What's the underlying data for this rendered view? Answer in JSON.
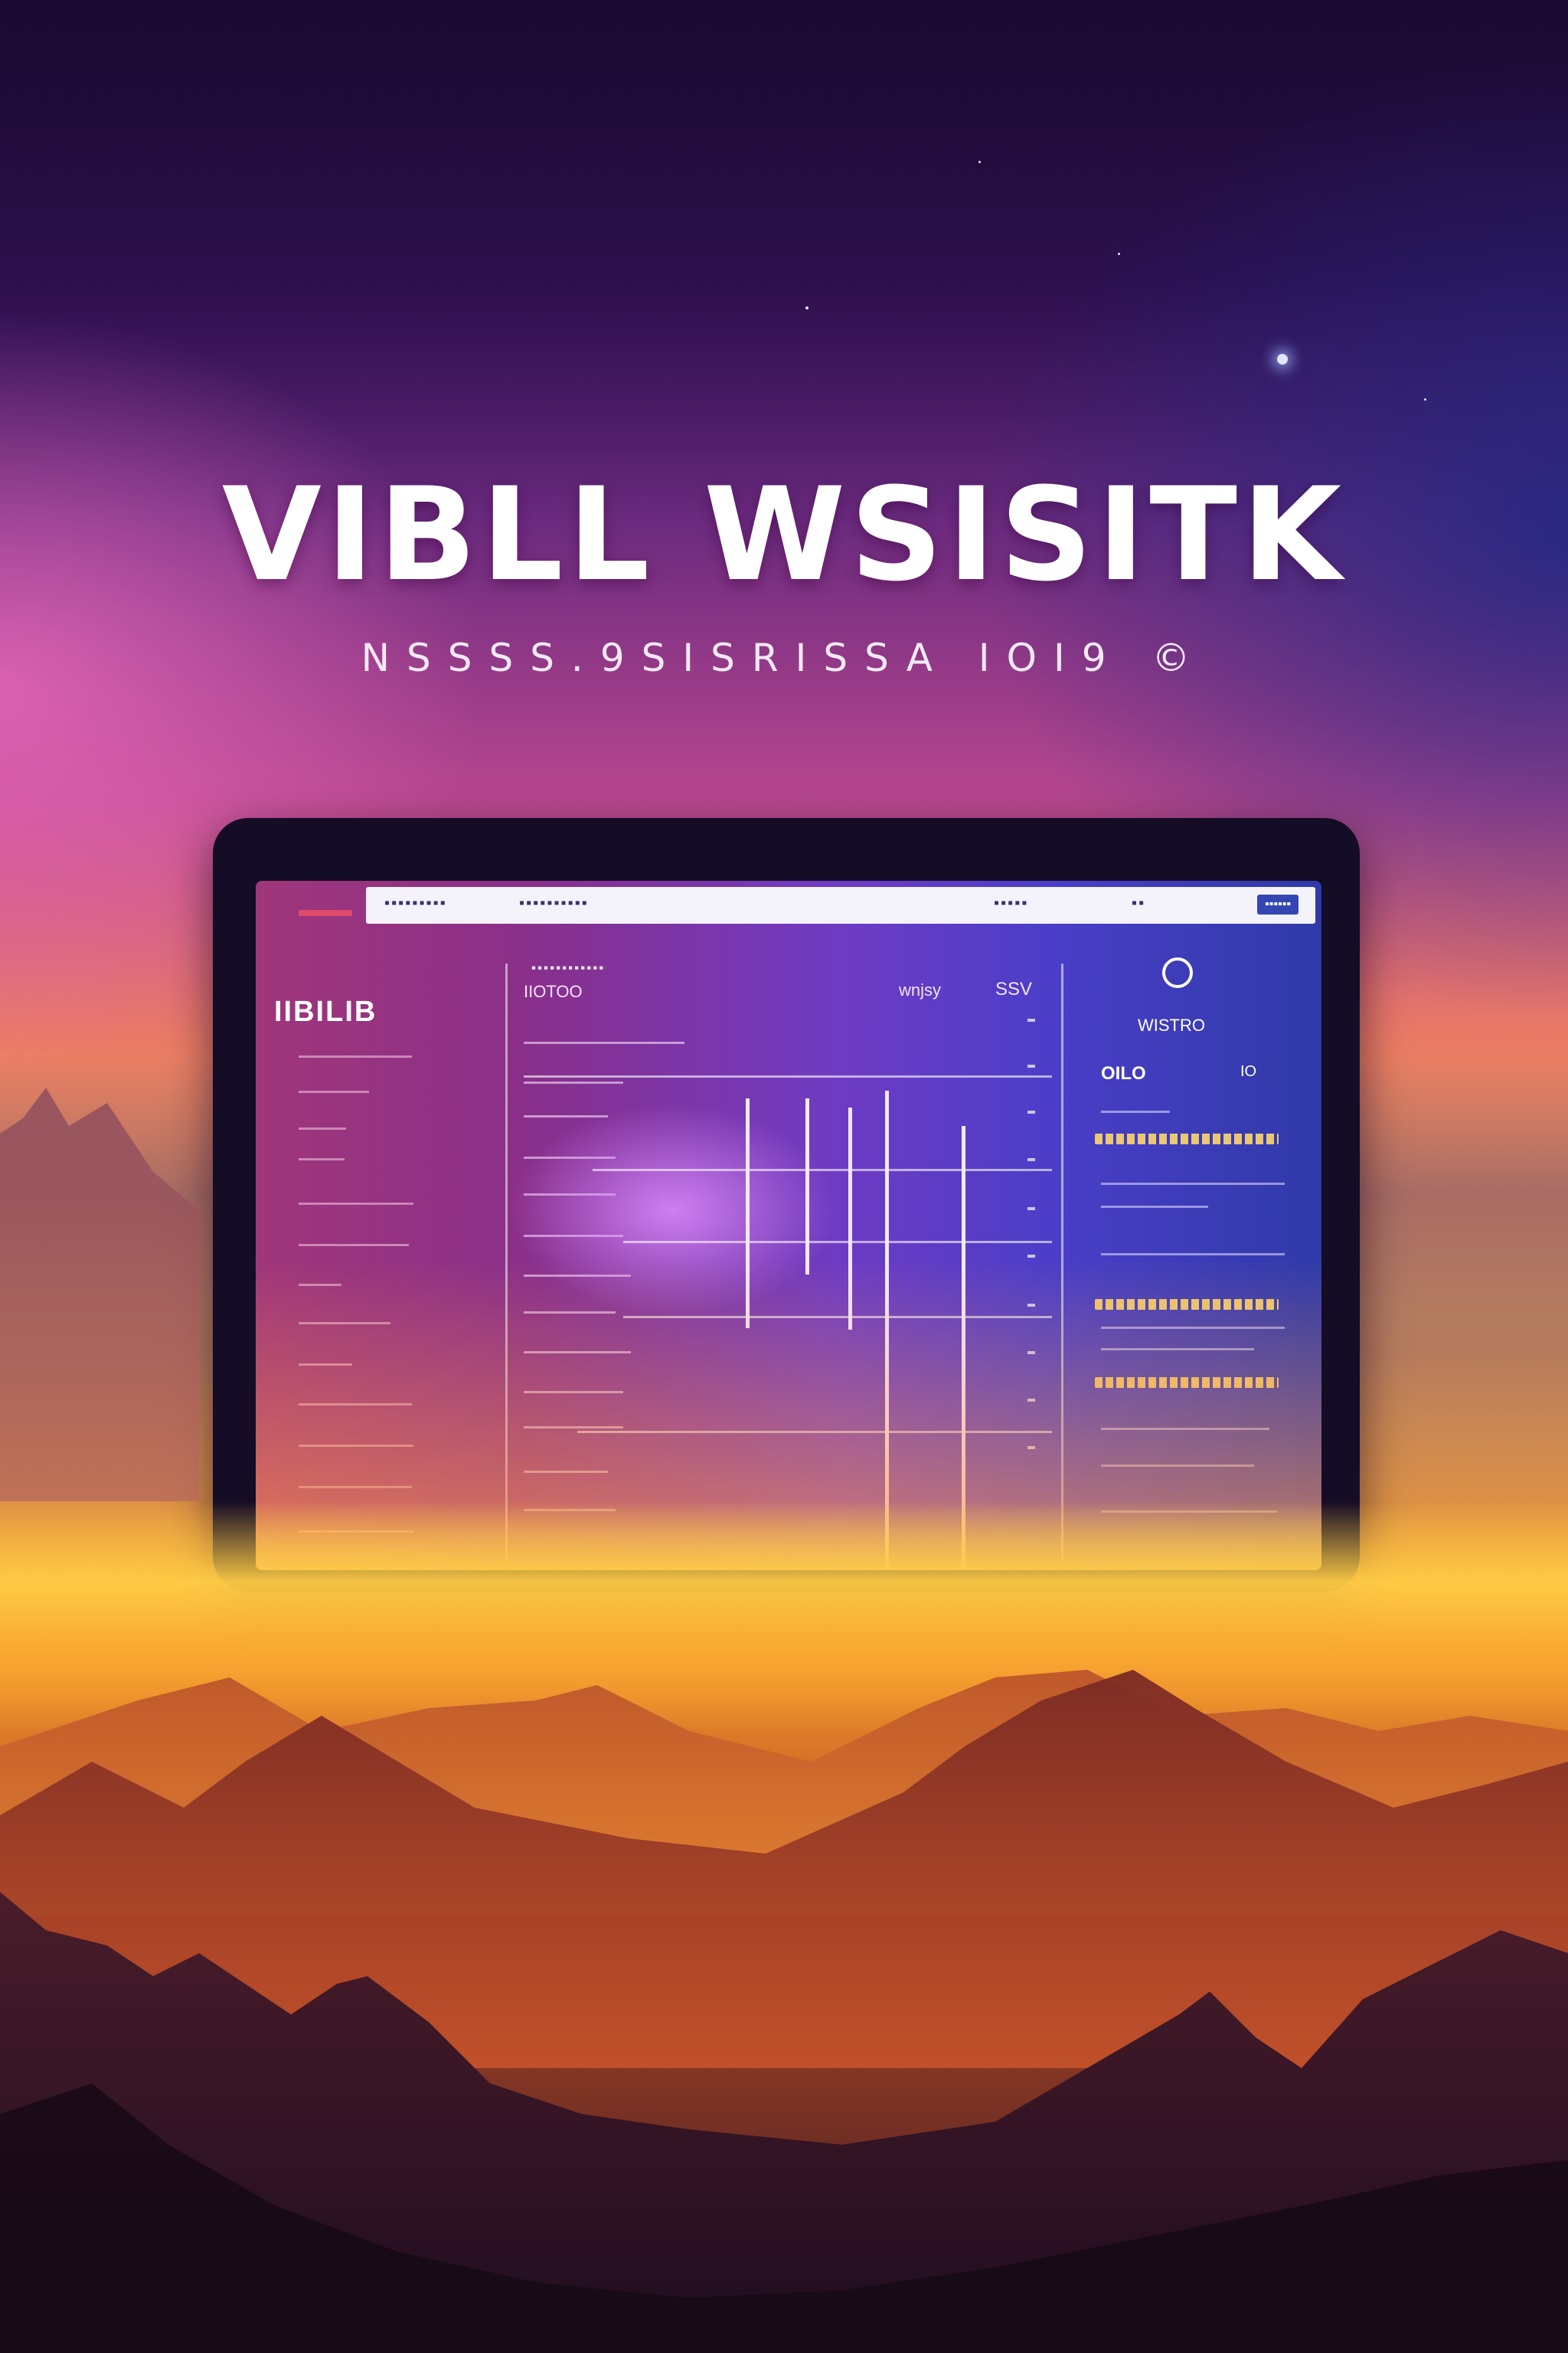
{
  "headline": "VIBLL WSISITK",
  "subline": "NSSSS.9SISRISSA IOI9 ©",
  "dashboard": {
    "side_title": "IIBILIB",
    "panel_header": "WISTRO",
    "panel_value_left": "OILO",
    "panel_value_right": "IO",
    "chart_header": "IIOTOO",
    "chart_corner_left": "wnjsy",
    "chart_corner_right": "SSV"
  },
  "colors": {
    "accent_blue": "#3346b3",
    "headline": "#ffffff",
    "gold": "#e9c774"
  }
}
